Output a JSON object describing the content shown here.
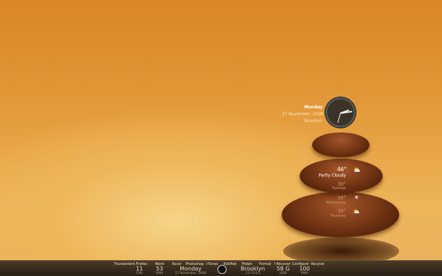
{
  "clock_widget": {
    "day": "Monday",
    "date": "17 November, 2008",
    "city": "Brooklyn"
  },
  "weather": {
    "current_temp": "46°",
    "current_cond": "Partly Cloudy",
    "forecast": [
      {
        "temp": "39°",
        "day": "Tuesday",
        "icon": "partly-cloudy-icon"
      },
      {
        "temp": "38°",
        "day": "Wednesday",
        "icon": "sunny-icon"
      },
      {
        "temp": "39°",
        "day": "Thursday",
        "icon": "partly-cloudy-icon"
      }
    ]
  },
  "dock": {
    "apps": [
      "Thunderbird",
      "Firefox",
      "Word",
      "Excel",
      "Photoshop",
      "I-Tunes",
      "EditPad",
      "Pidgin",
      "Format",
      "I-Recover",
      "Configure",
      "Recycle"
    ],
    "stats": {
      "cpu": {
        "value": "11",
        "label": "CPU"
      },
      "ram": {
        "value": "53",
        "label": "RAM"
      },
      "day": {
        "value": "Monday",
        "label": "17 November, 2008"
      },
      "net": {
        "value": "Brooklyn",
        "label": "127.0.0.1"
      },
      "hdd": {
        "value": "58 G",
        "label": "HDD"
      },
      "pwr": {
        "value": "100",
        "label": "PWR"
      }
    }
  }
}
